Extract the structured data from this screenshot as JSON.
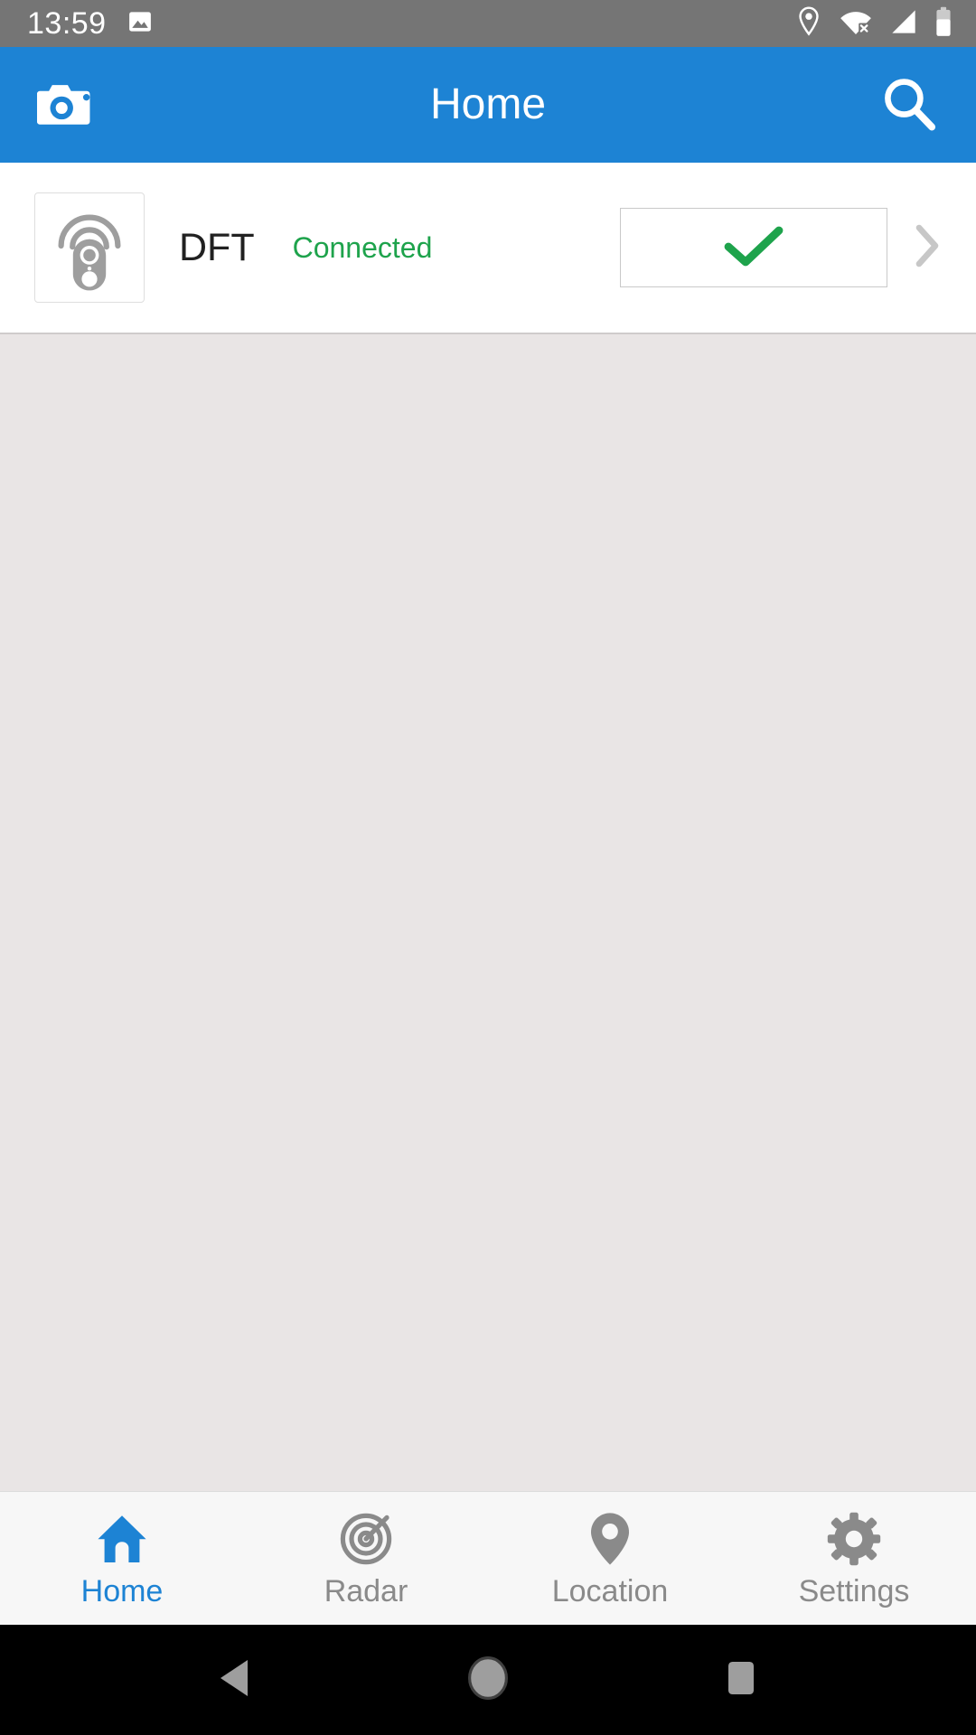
{
  "status_bar": {
    "time": "13:59",
    "left_icons": [
      {
        "name": "image-icon",
        "glyph": "image"
      }
    ],
    "right_icons": [
      {
        "name": "location-pin-icon",
        "glyph": "pin"
      },
      {
        "name": "wifi-off-icon",
        "glyph": "wifi-x"
      },
      {
        "name": "cellular-signal-icon",
        "glyph": "signal"
      },
      {
        "name": "battery-icon",
        "glyph": "battery"
      }
    ],
    "background_color": "#757575",
    "foreground_color": "#ffffff"
  },
  "app_bar": {
    "title": "Home",
    "background_color": "#1d83d4",
    "left_action": {
      "name": "camera-button",
      "icon": "camera-icon"
    },
    "right_action": {
      "name": "search-button",
      "icon": "search-icon"
    }
  },
  "device_list": {
    "rows": [
      {
        "thumbnail_icon": "beacon-tag-icon",
        "name": "DFT",
        "status": "Connected",
        "status_color": "#1ea34c",
        "action_icon": "checkmark-icon",
        "action_color": "#1ea34c",
        "disclosure_icon": "chevron-right-icon"
      }
    ]
  },
  "bottom_nav": {
    "active_index": 0,
    "active_color": "#1d83d4",
    "inactive_color": "#8a8a8a",
    "items": [
      {
        "label": "Home",
        "icon": "home-icon"
      },
      {
        "label": "Radar",
        "icon": "radar-icon"
      },
      {
        "label": "Location",
        "icon": "location-pin-icon"
      },
      {
        "label": "Settings",
        "icon": "gear-icon"
      }
    ]
  },
  "android_nav": {
    "back": "back-triangle-icon",
    "home": "home-circle-icon",
    "recents": "recents-square-icon"
  }
}
